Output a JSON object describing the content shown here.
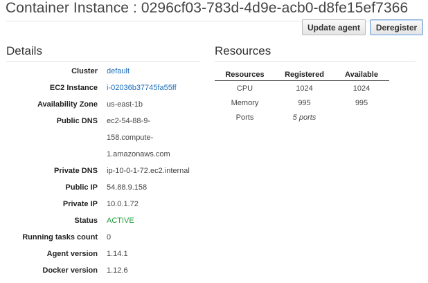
{
  "header": {
    "title": "Container Instance : 0296cf03-783d-4d9e-acb0-d8fe15ef7366",
    "update_agent_label": "Update agent",
    "deregister_label": "Deregister"
  },
  "details": {
    "title": "Details",
    "cluster_label": "Cluster",
    "cluster_value": "default",
    "ec2_label": "EC2 Instance",
    "ec2_value": "i-02036b37745fa55ff",
    "az_label": "Availability Zone",
    "az_value": "us-east-1b",
    "public_dns_label": "Public DNS",
    "public_dns_line1": "ec2-54-88-9-",
    "public_dns_line2": "158.compute-",
    "public_dns_line3": "1.amazonaws.com",
    "private_dns_label": "Private DNS",
    "private_dns_value": "ip-10-0-1-72.ec2.internal",
    "public_ip_label": "Public IP",
    "public_ip_value": "54.88.9.158",
    "private_ip_label": "Private IP",
    "private_ip_value": "10.0.1.72",
    "status_label": "Status",
    "status_value": "ACTIVE",
    "running_label": "Running tasks count",
    "running_value": "0",
    "agent_version_label": "Agent version",
    "agent_version_value": "1.14.1",
    "docker_version_label": "Docker version",
    "docker_version_value": "1.12.6"
  },
  "resources": {
    "title": "Resources",
    "headers": [
      "Resources",
      "Registered",
      "Available"
    ],
    "rows": [
      {
        "name": "CPU",
        "registered": "1024",
        "available": "1024"
      },
      {
        "name": "Memory",
        "registered": "995",
        "available": "995"
      },
      {
        "name": "Ports",
        "registered": "5 ports",
        "available": ""
      }
    ]
  },
  "colors": {
    "link": "#1a6bb8",
    "status_active": "#1f9c3a"
  }
}
